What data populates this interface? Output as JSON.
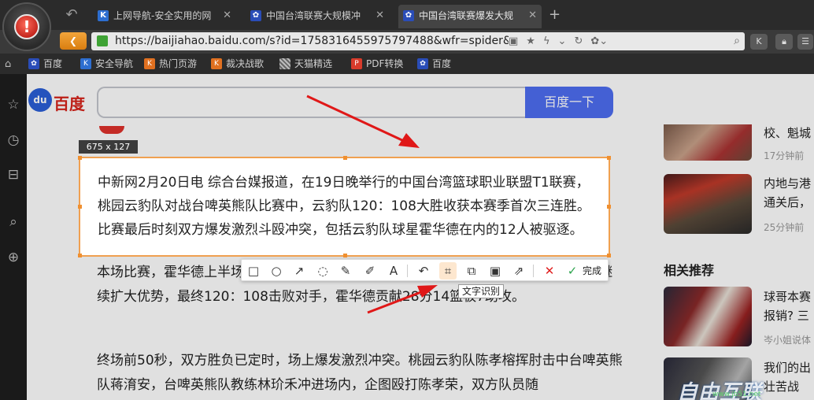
{
  "browser": {
    "tabs": [
      {
        "label": "上网导航-安全实用的网",
        "icon": "k-shield-icon"
      },
      {
        "label": "中国台湾联赛大规模冲",
        "icon": "baidu-paw-icon"
      },
      {
        "label": "中国台湾联赛爆发大规",
        "icon": "baidu-paw-icon",
        "active": true
      }
    ],
    "url": "https://baijiahao.baidu.com/s?id=1758316455975797488&wfr=spider&f...",
    "bookmarks": [
      "百度",
      "安全导航",
      "热门页游",
      "裁决战歌",
      "天猫精选",
      "PDF转换",
      "百度"
    ],
    "accent": "#e3951f"
  },
  "page": {
    "logo_text": "百度",
    "search_button": "百度一下",
    "search_value": "",
    "selected_paragraph": [
      "中新网2月20日电 综合台媒报道，在19日晚举行的中国台湾篮球职业联盟T1联赛，",
      "桃园云豹队对战台啤英熊队比赛中，云豹队120：108大胜收获本赛季首次三连胜。",
      "比赛最后时刻双方爆发激烈斗殴冲突，包括云豹队球星霍华德在内的12人被驱逐。"
    ],
    "paragraph2": "本场比赛，霍华德上半场就已豪取14分，帮助球队半场领先对手16分。下半场云豹队继续扩大优势，最终120：108击败对手，霍华德贡献28分14篮板7助攻。",
    "paragraph3": "终场前50秒，双方胜负已定时，场上爆发激烈冲突。桃园云豹队陈孝榕挥肘击中台啤英熊队蒋淯安，台啤英熊队教练林玠禾冲进场内，企图殴打陈孝荣，双方队员随",
    "sidebar": {
      "item1_title": "校、魁城",
      "item1_time": "17分钟前",
      "item2_title_1": "内地与港",
      "item2_title_2": "通关后，",
      "item2_time": "25分钟前",
      "related_heading": "相关推荐",
      "item3_title_1": "球哥本赛",
      "item3_title_2": "报销? 三",
      "item3_source": "岑小姐说体",
      "item4_title_1": "我们的出",
      "item4_title_2": "壮苦战"
    }
  },
  "capture_tool": {
    "size_label": "675 x 127",
    "tools": [
      "rectangle-icon",
      "ellipse-icon",
      "arrow-icon",
      "speech-bubble-icon",
      "brush-icon",
      "marker-icon",
      "text-icon",
      "undo-icon",
      "ocr-icon",
      "translate-icon",
      "save-icon",
      "share-icon",
      "cancel-icon",
      "confirm-icon"
    ],
    "done_label": "完成",
    "tooltip": "文字识别",
    "highlight_color": "#f0a050"
  },
  "watermark": {
    "text": "自由互联",
    "sub": "www.jb51.net"
  }
}
